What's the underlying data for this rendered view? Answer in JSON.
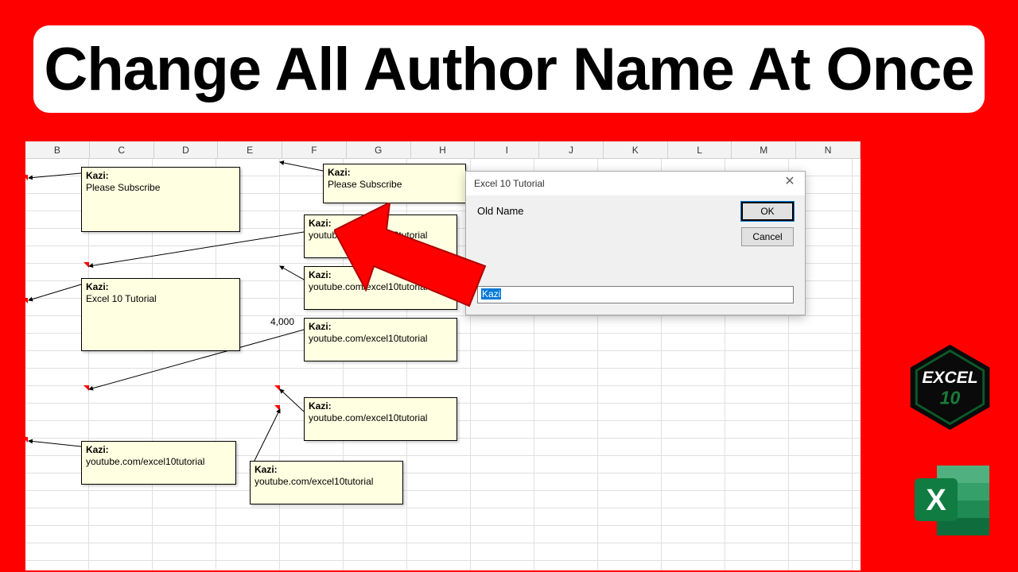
{
  "banner": {
    "title": "Change All Author Name At Once"
  },
  "columns": [
    "B",
    "C",
    "D",
    "E",
    "F",
    "G",
    "H",
    "I",
    "J",
    "K",
    "L",
    "M",
    "N"
  ],
  "cell_value": "4,000",
  "comments": {
    "c1": {
      "author": "Kazi:",
      "body": "Please Subscribe"
    },
    "c2": {
      "author": "Kazi:",
      "body": "Please Subscribe"
    },
    "c3": {
      "author": "Kazi:",
      "body": "youtube.com/excel10tutorial"
    },
    "c4": {
      "author": "Kazi:",
      "body": "Excel 10 Tutorial"
    },
    "c5": {
      "author": "Kazi:",
      "body": "youtube.com/excel10tutorial"
    },
    "c6": {
      "author": "Kazi:",
      "body": "youtube.com/excel10tutorial"
    },
    "c7": {
      "author": "Kazi:",
      "body": "youtube.com/excel10tutorial"
    },
    "c8": {
      "author": "Kazi:",
      "body": "youtube.com/excel10tutorial"
    },
    "c9": {
      "author": "Kazi:",
      "body": "youtube.com/excel10tutorial"
    }
  },
  "dialog": {
    "title": "Excel 10 Tutorial",
    "label": "Old Name",
    "ok": "OK",
    "cancel": "Cancel",
    "input_value": "Kazi"
  },
  "badges": {
    "hex_top": "EXCEL",
    "hex_bottom": "10",
    "excel_letter": "X"
  }
}
